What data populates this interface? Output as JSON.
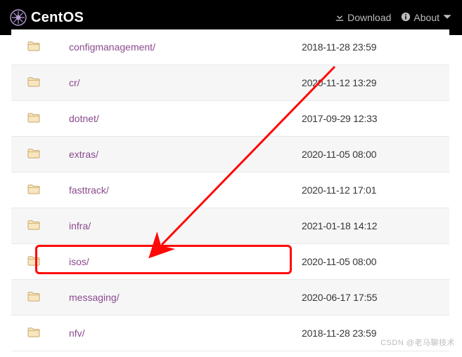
{
  "header": {
    "brand": "CentOS",
    "download_label": "Download",
    "about_label": "About"
  },
  "rows": [
    {
      "name": "configmanagement/",
      "date": "2018-11-28 23:59"
    },
    {
      "name": "cr/",
      "date": "2020-11-12 13:29"
    },
    {
      "name": "dotnet/",
      "date": "2017-09-29 12:33"
    },
    {
      "name": "extras/",
      "date": "2020-11-05 08:00"
    },
    {
      "name": "fasttrack/",
      "date": "2020-11-12 17:01"
    },
    {
      "name": "infra/",
      "date": "2021-01-18 14:12"
    },
    {
      "name": "isos/",
      "date": "2020-11-05 08:00"
    },
    {
      "name": "messaging/",
      "date": "2020-06-17 17:55"
    },
    {
      "name": "nfv/",
      "date": "2018-11-28 23:59"
    }
  ],
  "watermark": "CSDN @老马聊技术"
}
